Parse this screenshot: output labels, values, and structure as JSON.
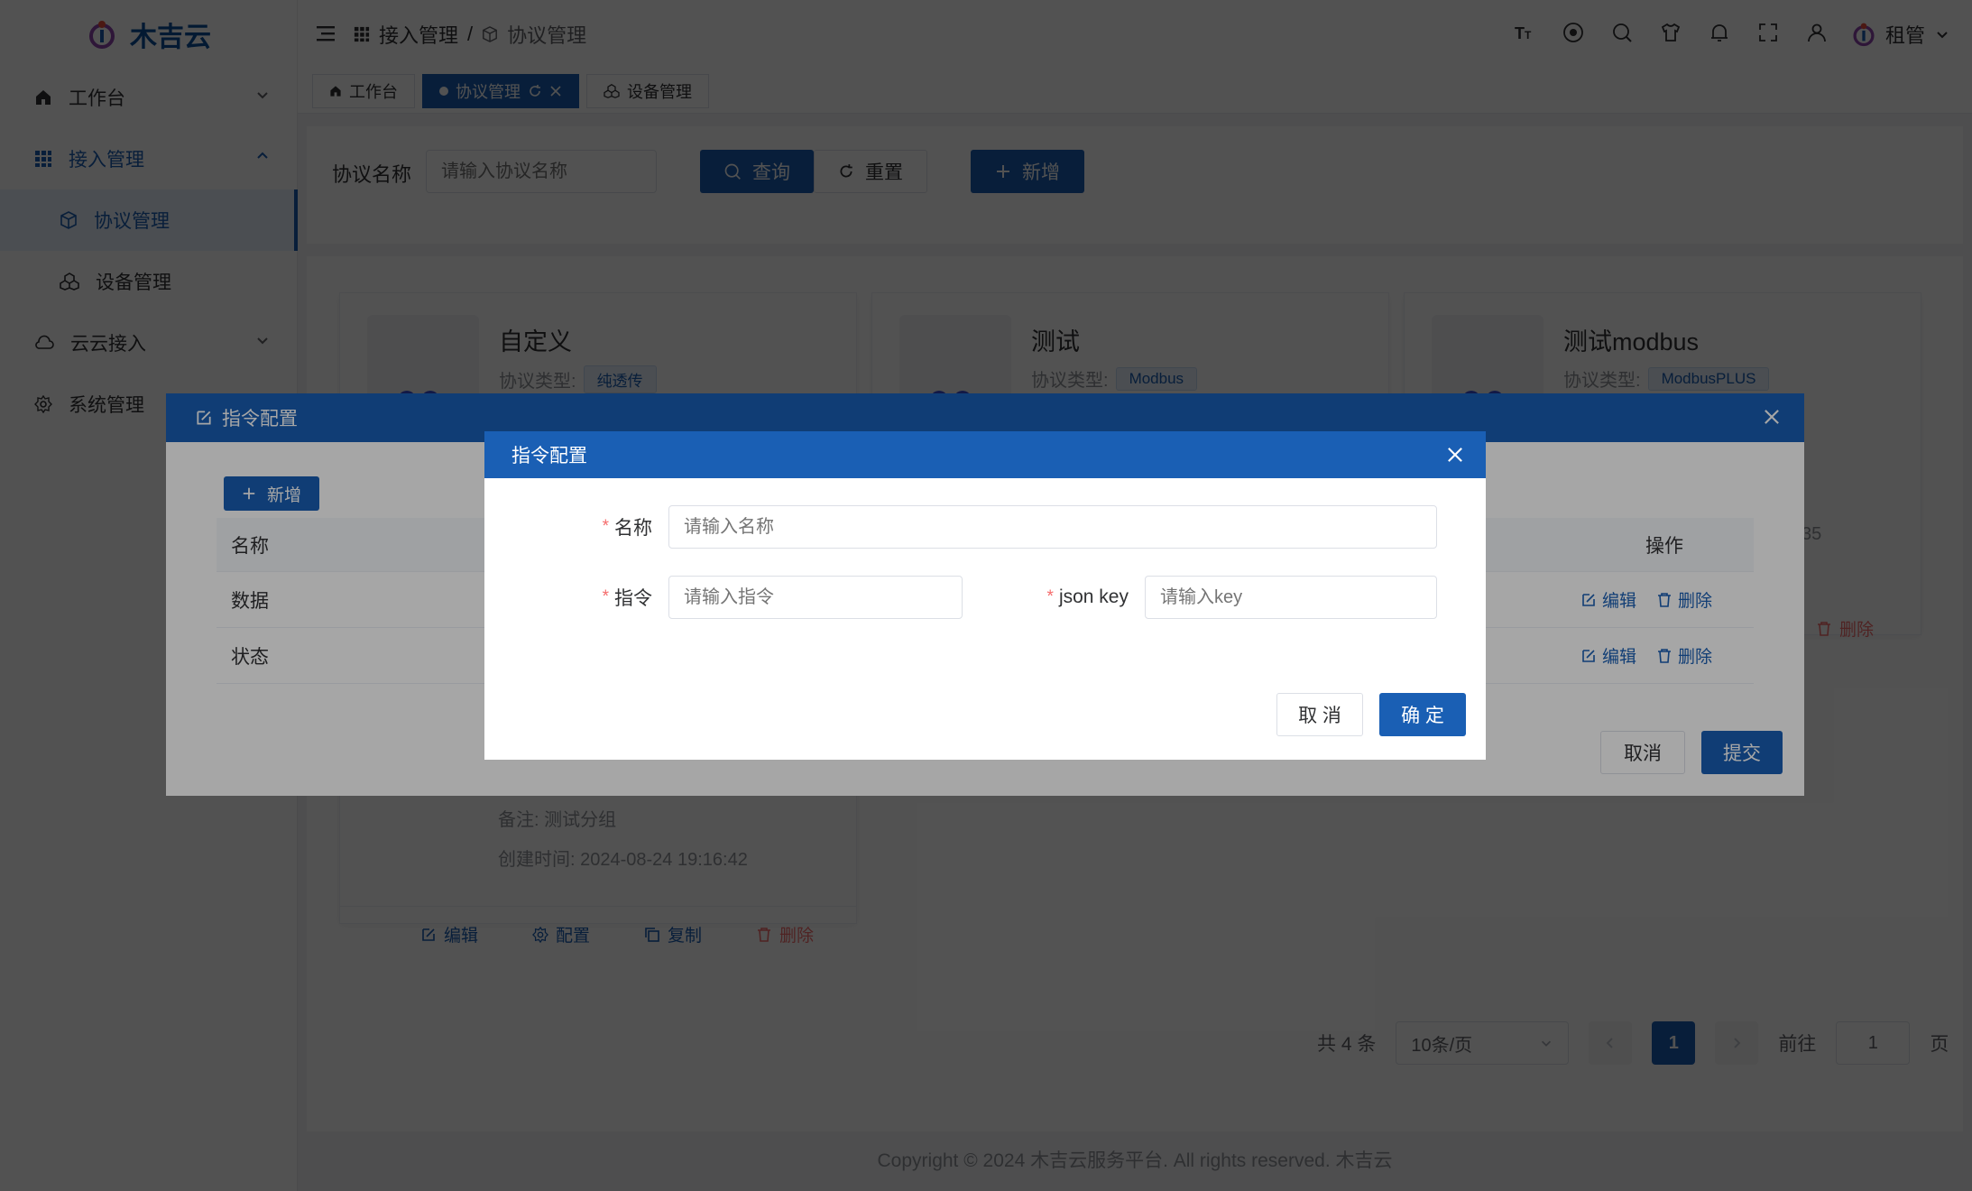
{
  "app": {
    "logo_text": "木吉云"
  },
  "sidebar": {
    "items": [
      {
        "label": "工作台",
        "icon": "home-icon"
      },
      {
        "label": "接入管理",
        "icon": "grid-icon"
      },
      {
        "label": "协议管理",
        "icon": "cube-icon"
      },
      {
        "label": "设备管理",
        "icon": "devices-icon"
      },
      {
        "label": "云云接入",
        "icon": "cloud-icon"
      },
      {
        "label": "系统管理",
        "icon": "gear-icon"
      }
    ]
  },
  "header": {
    "breadcrumb": [
      "接入管理",
      "/",
      "协议管理"
    ],
    "user": "租管"
  },
  "tabs": [
    {
      "label": "工作台"
    },
    {
      "label": "协议管理"
    },
    {
      "label": "设备管理"
    }
  ],
  "search": {
    "label": "协议名称",
    "placeholder": "请输入协议名称",
    "query_btn": "查询",
    "reset_btn": "重置",
    "add_btn": "新增"
  },
  "cards": [
    {
      "title": "自定义",
      "type_label": "协议类型:",
      "type": "纯透传"
    },
    {
      "title": "测试",
      "type_label": "协议类型:",
      "type": "Modbus"
    },
    {
      "title": "测试modbus",
      "type_label": "协议类型:",
      "type": "ModbusPLUS"
    }
  ],
  "card4": {
    "remark": "备注: 测试分组",
    "created": "创建时间: 2024-08-24 19:16:42",
    "actions": {
      "edit": "编辑",
      "config": "配置",
      "copy": "复制",
      "delete": "删除"
    }
  },
  "card3_partial": {
    "tail_text": "35",
    "delete": "删除"
  },
  "pagination": {
    "total": "共 4 条",
    "page_size": "10条/页",
    "current": "1",
    "goto_prefix": "前往",
    "goto_value": "1",
    "goto_suffix": "页"
  },
  "footer": {
    "text": "Copyright © 2024 木吉云服务平台. All rights reserved. 木吉云"
  },
  "outer_dialog": {
    "title": "指令配置",
    "add_btn": "新增",
    "col_name": "名称",
    "col_ops": "操作",
    "rows": [
      {
        "name": "数据",
        "edit": "编辑",
        "delete": "删除"
      },
      {
        "name": "状态",
        "edit": "编辑",
        "delete": "删除"
      }
    ],
    "cancel": "取消",
    "submit": "提交"
  },
  "inner_dialog": {
    "title": "指令配置",
    "name_label": "名称",
    "name_placeholder": "请输入名称",
    "cmd_label": "指令",
    "cmd_placeholder": "请输入指令",
    "key_label": "json key",
    "key_placeholder": "请输入key",
    "cancel": "取 消",
    "confirm": "确 定"
  },
  "colors": {
    "primary": "#1a5fb4",
    "danger": "#f56c6c"
  }
}
